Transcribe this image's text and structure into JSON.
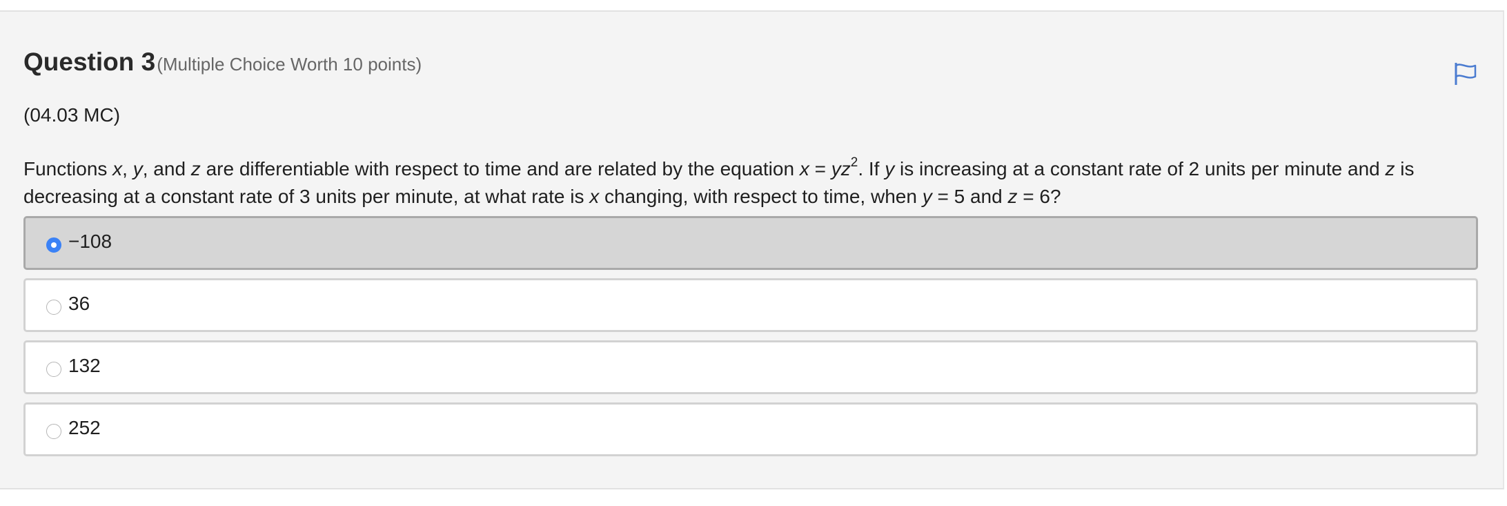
{
  "question": {
    "title": "Question 3",
    "subtitle": "(Multiple Choice Worth 10 points)",
    "code": "(04.03 MC)",
    "prompt": {
      "p1": "Functions ",
      "v1": "x",
      "p2": ", ",
      "v2": "y",
      "p3": ", and ",
      "v3": "z",
      "p4": " are differentiable with respect to time and are related by the equation ",
      "v4": "x",
      "p5": " = ",
      "v5": "yz",
      "sup": "2",
      "p6": ". If ",
      "v6": "y",
      "p7": " is increasing at a constant rate of 2 units per minute and ",
      "v7": "z",
      "p8": " is decreasing at a constant rate of 3 units per minute, at what rate is ",
      "v8": "x",
      "p9": " changing, with respect to time, when ",
      "v9": "y",
      "p10": " = 5 and ",
      "v10": "z",
      "p11": " = 6?"
    },
    "flag_icon": "flag-icon",
    "flag_color": "#4a7bd0"
  },
  "choices": [
    {
      "label": "−108",
      "selected": true
    },
    {
      "label": "36",
      "selected": false
    },
    {
      "label": "132",
      "selected": false
    },
    {
      "label": "252",
      "selected": false
    }
  ],
  "colors": {
    "selected_radio": "#3b82f6",
    "selected_background": "#d6d6d6",
    "card_background": "#f4f4f4"
  }
}
